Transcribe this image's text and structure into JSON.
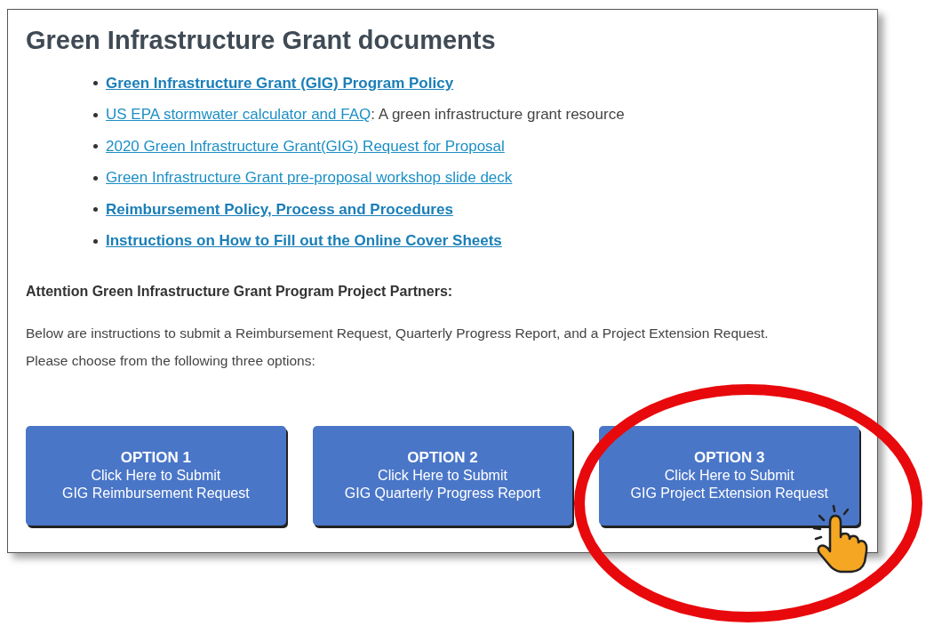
{
  "heading": "Green Infrastructure Grant documents",
  "links": [
    {
      "text": "Green Infrastructure Grant (GIG) Program Policy",
      "bold": true
    },
    {
      "text": "US EPA stormwater calculator and FAQ",
      "bold": false,
      "suffix": ": A green infrastructure grant resource"
    },
    {
      "text": "2020 Green Infrastructure Grant(GIG) Request for Proposal",
      "bold": false
    },
    {
      "text": "Green Infrastructure Grant pre-proposal workshop slide deck",
      "bold": false
    },
    {
      "text": "Reimbursement Policy, Process and Procedures",
      "bold": true
    },
    {
      "text": "Instructions on How to Fill out the Online Cover Sheets",
      "bold": true
    }
  ],
  "attention": "Attention Green Infrastructure Grant Program Project Partners:",
  "intro": [
    "Below are instructions to submit a Reimbursement Request, Quarterly Progress Report, and a Project Extension Request.",
    "Please choose from the following three options:"
  ],
  "options": [
    {
      "title": "OPTION 1",
      "lines": [
        "Click Here to Submit",
        "GIG Reimbursement Request"
      ],
      "highlighted": false
    },
    {
      "title": "OPTION 2",
      "lines": [
        "Click Here to Submit",
        "GIG Quarterly Progress Report"
      ],
      "highlighted": false
    },
    {
      "title": "OPTION 3",
      "lines": [
        "Click Here to Submit",
        "GIG Project Extension Request"
      ],
      "highlighted": true
    }
  ]
}
